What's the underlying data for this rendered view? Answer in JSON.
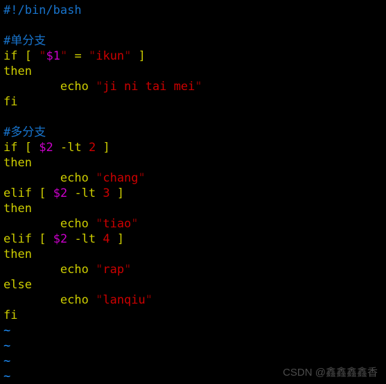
{
  "app": {
    "type": "terminal-text-editor",
    "editor": "vim",
    "background_color": "#000000"
  },
  "colors": {
    "comment": "#1874CD",
    "keyword": "#CDCD00",
    "variable": "#CD00CD",
    "string": "#CD0000",
    "quote": "#8B0000",
    "number": "#CD0000",
    "tilde": "#1E90FF",
    "watermark": "#5a5a5a"
  },
  "buffer": {
    "lines": [
      {
        "id": "l1",
        "kind": "comment",
        "text": "#!/bin/bash"
      },
      {
        "id": "l2",
        "kind": "blank",
        "text": ""
      },
      {
        "id": "l3",
        "kind": "comment",
        "text": "#单分支"
      },
      {
        "id": "l4",
        "kind": "code",
        "text": "if [ \"$1\" = \"ikun\" ]"
      },
      {
        "id": "l5",
        "kind": "code",
        "text": "then"
      },
      {
        "id": "l6",
        "kind": "code",
        "text": "        echo \"ji ni tai mei\""
      },
      {
        "id": "l7",
        "kind": "code",
        "text": "fi"
      },
      {
        "id": "l8",
        "kind": "blank",
        "text": ""
      },
      {
        "id": "l9",
        "kind": "comment",
        "text": "#多分支"
      },
      {
        "id": "l10",
        "kind": "code",
        "text": "if [ $2 -lt 2 ]"
      },
      {
        "id": "l11",
        "kind": "code",
        "text": "then"
      },
      {
        "id": "l12",
        "kind": "code",
        "text": "        echo \"chang\""
      },
      {
        "id": "l13",
        "kind": "code",
        "text": "elif [ $2 -lt 3 ]"
      },
      {
        "id": "l14",
        "kind": "code",
        "text": "then"
      },
      {
        "id": "l15",
        "kind": "code",
        "text": "        echo \"tiao\""
      },
      {
        "id": "l16",
        "kind": "code",
        "text": "elif [ $2 -lt 4 ]"
      },
      {
        "id": "l17",
        "kind": "code",
        "text": "then"
      },
      {
        "id": "l18",
        "kind": "code",
        "text": "        echo \"rap\""
      },
      {
        "id": "l19",
        "kind": "code",
        "text": "else"
      },
      {
        "id": "l20",
        "kind": "code",
        "text": "        echo \"lanqiu\""
      },
      {
        "id": "l21",
        "kind": "code",
        "text": "fi"
      }
    ],
    "empty_markers": [
      "~",
      "~",
      "~",
      "~"
    ]
  },
  "tokens": {
    "line1": {
      "shebang": "#!/bin/bash"
    },
    "line3": {
      "comment": "#单分支"
    },
    "line4": {
      "kw_if": "if",
      "br_open": "[",
      "q1": "\"",
      "var": "$1",
      "q2": "\"",
      "op_eq": "=",
      "q3": "\"",
      "str": "ikun",
      "q4": "\"",
      "br_close": "]"
    },
    "line5": {
      "kw_then": "then"
    },
    "line6": {
      "indent": "        ",
      "kw_echo": "echo",
      "q1": "\"",
      "str": "ji ni tai mei",
      "q2": "\""
    },
    "line7": {
      "kw_fi": "fi"
    },
    "line9": {
      "comment": "#多分支"
    },
    "line10": {
      "kw_if": "if",
      "br_open": "[",
      "var": "$2",
      "op_lt": "-lt",
      "num": "2",
      "br_close": "]"
    },
    "line11": {
      "kw_then": "then"
    },
    "line12": {
      "indent": "        ",
      "kw_echo": "echo",
      "q1": "\"",
      "str": "chang",
      "q2": "\""
    },
    "line13": {
      "kw_elif": "elif",
      "br_open": "[",
      "var": "$2",
      "op_lt": "-lt",
      "num": "3",
      "br_close": "]"
    },
    "line14": {
      "kw_then": "then"
    },
    "line15": {
      "indent": "        ",
      "kw_echo": "echo",
      "q1": "\"",
      "str": "tiao",
      "q2": "\""
    },
    "line16": {
      "kw_elif": "elif",
      "br_open": "[",
      "var": "$2",
      "op_lt": "-lt",
      "num": "4",
      "br_close": "]"
    },
    "line17": {
      "kw_then": "then"
    },
    "line18": {
      "indent": "        ",
      "kw_echo": "echo",
      "q1": "\"",
      "str": "rap",
      "q2": "\""
    },
    "line19": {
      "kw_else": "else"
    },
    "line20": {
      "indent": "        ",
      "kw_echo": "echo",
      "q1": "\"",
      "str": "lanqiu",
      "q2": "\""
    },
    "line21": {
      "kw_fi": "fi"
    }
  },
  "watermark": {
    "prefix": "CSDN @",
    "name": "鑫鑫鑫鑫香"
  }
}
